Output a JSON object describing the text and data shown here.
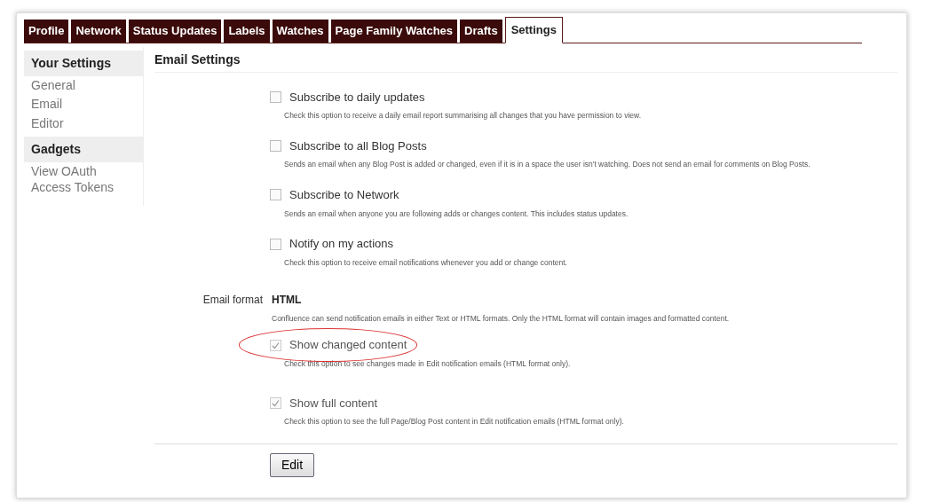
{
  "tabs": [
    {
      "label": "Profile",
      "selected": false
    },
    {
      "label": "Network",
      "selected": false
    },
    {
      "label": "Status Updates",
      "selected": false
    },
    {
      "label": "Labels",
      "selected": false
    },
    {
      "label": "Watches",
      "selected": false
    },
    {
      "label": "Page Family Watches",
      "selected": false
    },
    {
      "label": "Drafts",
      "selected": false
    },
    {
      "label": "Settings",
      "selected": true
    }
  ],
  "sidebar": {
    "sections": [
      {
        "heading": "Your Settings",
        "items": [
          "General",
          "Email",
          "Editor"
        ]
      },
      {
        "heading": "Gadgets",
        "items": [
          "View OAuth Access Tokens"
        ]
      }
    ]
  },
  "email_settings": {
    "title": "Email Settings",
    "options": [
      {
        "label": "Subscribe to daily updates",
        "description": "Check this option to receive a daily email report summarising all changes that you have permission to view.",
        "checked": false,
        "disabled": false,
        "highlighted": false
      },
      {
        "label": "Subscribe to all Blog Posts",
        "description": "Sends an email when any Blog Post is added or changed, even if it is in a space the user isn't watching. Does not send an email for comments on Blog Posts.",
        "checked": false,
        "disabled": false,
        "highlighted": false
      },
      {
        "label": "Subscribe to Network",
        "description": "Sends an email when anyone you are following adds or changes content. This includes status updates.",
        "checked": false,
        "disabled": false,
        "highlighted": false
      },
      {
        "label": "Notify on my actions",
        "description": "Check this option to receive email notifications whenever you add or change content.",
        "checked": false,
        "disabled": false,
        "highlighted": false
      }
    ],
    "format": {
      "label": "Email format",
      "value": "HTML",
      "description": "Confluence can send notification emails in either Text or HTML formats. Only the HTML format will contain images and formatted content."
    },
    "format_options": [
      {
        "label": "Show changed content",
        "description": "Check this option to see changes made in Edit notification emails (HTML format only).",
        "checked": true,
        "disabled": true,
        "highlighted": true
      },
      {
        "label": "Show full content",
        "description": "Check this option to see the full Page/Blog Post content in Edit notification emails (HTML format only).",
        "checked": true,
        "disabled": true,
        "highlighted": false
      }
    ],
    "button": "Edit"
  }
}
